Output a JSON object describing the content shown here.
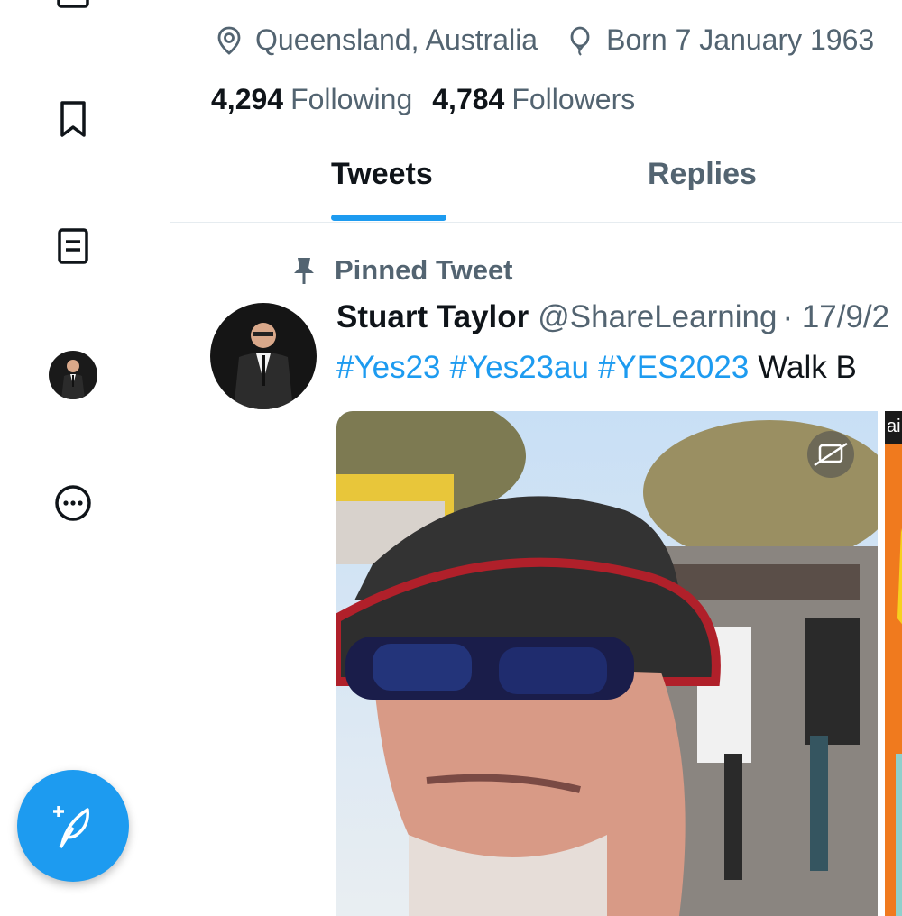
{
  "profile": {
    "location": "Queensland, Australia",
    "birth": "Born 7 January 1963",
    "following_count": "4,294",
    "following_label": "Following",
    "followers_count": "4,784",
    "followers_label": "Followers"
  },
  "tabs": [
    {
      "label": "Tweets",
      "active": true
    },
    {
      "label": "Replies",
      "active": false
    }
  ],
  "pinned": {
    "label": "Pinned Tweet",
    "author_name": "Stuart Taylor",
    "author_handle": "@ShareLearning",
    "date": "· 17/9/2",
    "hashtags": [
      "#Yes23",
      "#Yes23au",
      "#YES2023"
    ],
    "text_after": "Walk B"
  },
  "second_media_label": "ai",
  "colors": {
    "accent": "#1d9bf0",
    "text_primary": "#0f1419",
    "text_secondary": "#536471",
    "border": "#e6ecf0"
  },
  "icons": [
    "bookmark-icon",
    "lists-icon",
    "more-icon",
    "compose-tweet-icon",
    "location-icon",
    "balloon-icon",
    "pin-icon",
    "captions-icon"
  ]
}
